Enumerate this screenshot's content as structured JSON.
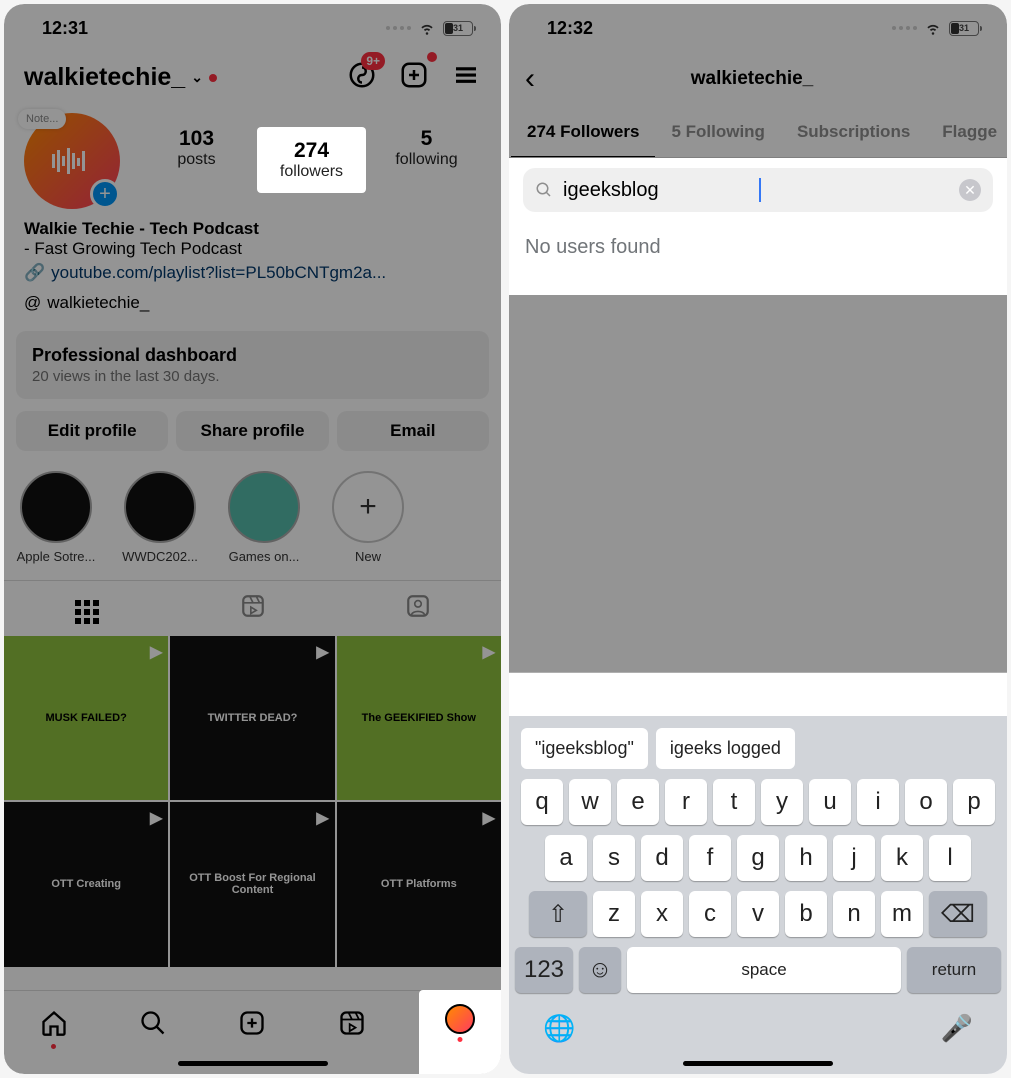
{
  "left": {
    "status": {
      "time": "12:31",
      "battery": "31"
    },
    "header": {
      "username": "walkietechie_",
      "badge": "9+"
    },
    "avatar": {
      "note": "Note..."
    },
    "stats": {
      "posts": {
        "count": "103",
        "label": "posts"
      },
      "followers": {
        "count": "274",
        "label": "followers"
      },
      "following": {
        "count": "5",
        "label": "following"
      }
    },
    "bio": {
      "name": "Walkie Techie - Tech Podcast",
      "desc": "- Fast Growing Tech Podcast",
      "link": "youtube.com/playlist?list=PL50bCNTgm2a...",
      "threads": "walkietechie_"
    },
    "dashboard": {
      "title": "Professional dashboard",
      "sub": "20 views in the last 30 days."
    },
    "actions": {
      "edit": "Edit profile",
      "share": "Share profile",
      "email": "Email"
    },
    "highlights": [
      {
        "label": "Apple Sotre..."
      },
      {
        "label": "WWDC202..."
      },
      {
        "label": "Games on..."
      },
      {
        "label": "New"
      }
    ],
    "posts": [
      {
        "text": "MUSK FAILED?"
      },
      {
        "text": "TWITTER DEAD?"
      },
      {
        "text": "The GEEKIFIED Show"
      },
      {
        "text": "OTT Creating"
      },
      {
        "text": "OTT Boost For Regional Content"
      },
      {
        "text": "OTT Platforms"
      }
    ]
  },
  "right": {
    "status": {
      "time": "12:32",
      "battery": "31"
    },
    "title": "walkietechie_",
    "tabs": [
      {
        "label": "274 Followers",
        "active": true
      },
      {
        "label": "5 Following",
        "active": false
      },
      {
        "label": "Subscriptions",
        "active": false
      },
      {
        "label": "Flagge",
        "active": false
      }
    ],
    "search": {
      "value": "igeeksblog"
    },
    "result": "No users found",
    "suggestions": [
      "\"igeeksblog\"",
      "igeeks logged"
    ],
    "keyboard": {
      "row1": [
        "q",
        "w",
        "e",
        "r",
        "t",
        "y",
        "u",
        "i",
        "o",
        "p"
      ],
      "row2": [
        "a",
        "s",
        "d",
        "f",
        "g",
        "h",
        "j",
        "k",
        "l"
      ],
      "row3": [
        "z",
        "x",
        "c",
        "v",
        "b",
        "n",
        "m"
      ],
      "row4": {
        "num": "123",
        "space": "space",
        "ret": "return"
      }
    }
  }
}
